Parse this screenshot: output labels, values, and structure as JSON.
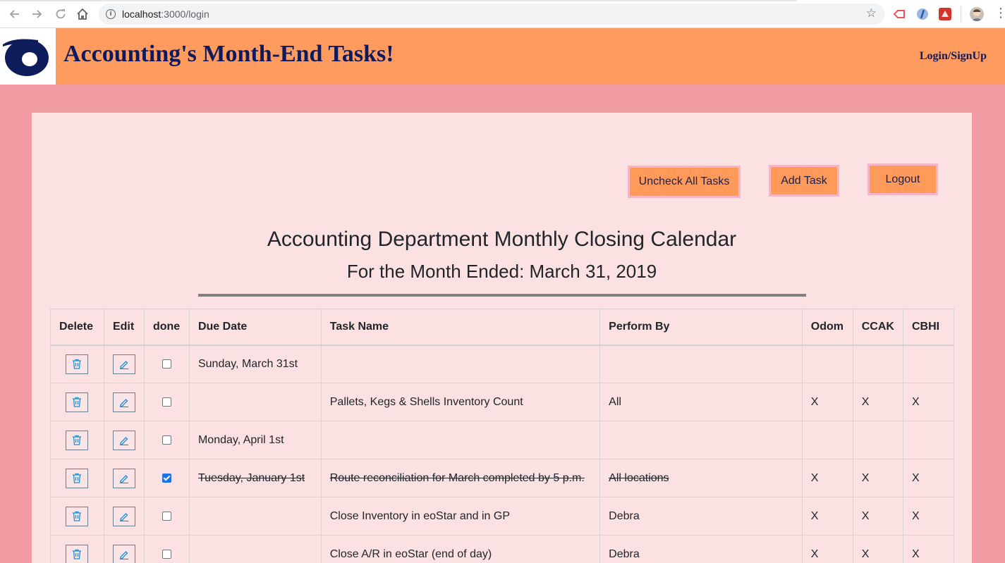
{
  "browser": {
    "url_host": "localhost",
    "url_rest": ":3000/login"
  },
  "header": {
    "title": "Accounting's Month-End Tasks!",
    "login_link": "Login/SignUp"
  },
  "actions": {
    "uncheck_all": "Uncheck All Tasks",
    "add_task": "Add Task",
    "logout": "Logout"
  },
  "calendar": {
    "title": "Accounting Department Monthly Closing Calendar",
    "subtitle": "For the Month Ended: March 31, 2019"
  },
  "table": {
    "columns": [
      "Delete",
      "Edit",
      "done",
      "Due Date",
      "Task Name",
      "Perform By",
      "Odom",
      "CCAK",
      "CBHI"
    ],
    "rows": [
      {
        "due": "Sunday, March 31st",
        "task": "",
        "by": "",
        "odom": "",
        "ccak": "",
        "cbhi": "",
        "done": false
      },
      {
        "due": "",
        "task": "Pallets, Kegs & Shells Inventory Count",
        "by": "All",
        "odom": "X",
        "ccak": "X",
        "cbhi": "X",
        "done": false
      },
      {
        "due": "Monday, April 1st",
        "task": "",
        "by": "",
        "odom": "",
        "ccak": "",
        "cbhi": "",
        "done": false
      },
      {
        "due": "Tuesday, January 1st",
        "task": "Route reconciliation for March completed by 5 p.m.",
        "by": "All locations",
        "odom": "X",
        "ccak": "X",
        "cbhi": "X",
        "done": true
      },
      {
        "due": "",
        "task": "Close Inventory in eoStar and in GP",
        "by": "Debra",
        "odom": "X",
        "ccak": "X",
        "cbhi": "X",
        "done": false
      },
      {
        "due": "",
        "task": "Close A/R in eoStar (end of day)",
        "by": "Debra",
        "odom": "X",
        "ccak": "X",
        "cbhi": "X",
        "done": false
      }
    ]
  },
  "colors": {
    "header_bg": "#ff9b5f",
    "page_bg": "#f19ca2",
    "card_bg": "#fbe1e2",
    "button_bg": "#ff9a5a",
    "title_color": "#0d1b5e",
    "icon_blue": "#1a8fd6"
  },
  "icons": {
    "delete": "trash-icon",
    "edit": "pencil-icon",
    "logo": "logo-icon"
  }
}
